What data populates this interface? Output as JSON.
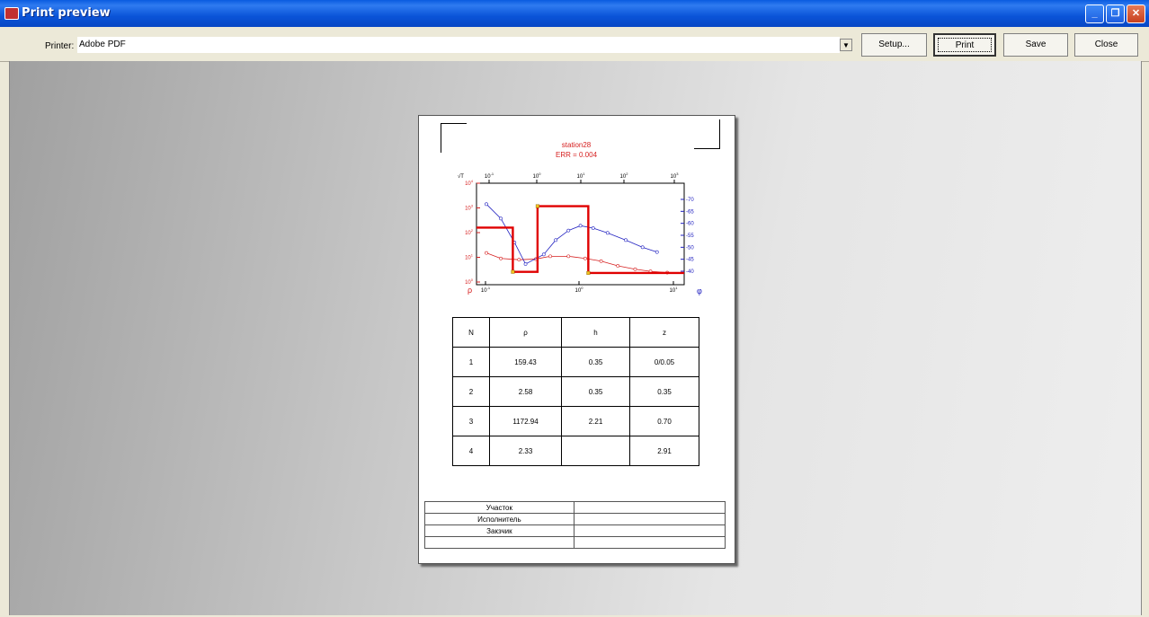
{
  "window": {
    "title": "Print preview"
  },
  "toolbar": {
    "printer_label": "Printer:",
    "printer_value": "Adobe PDF",
    "setup": "Setup...",
    "print": "Print",
    "save": "Save",
    "close": "Close"
  },
  "report": {
    "chart_title": "station28",
    "chart_subtitle": "ERR = 0.004",
    "table_headers": [
      "N",
      "ρ",
      "h",
      "z"
    ],
    "table_rows": [
      [
        "1",
        "159.43",
        "0.35",
        "0/0.05"
      ],
      [
        "2",
        "2.58",
        "0.35",
        "0.35"
      ],
      [
        "3",
        "1172.94",
        "2.21",
        "0.70"
      ],
      [
        "4",
        "2.33",
        "",
        "2.91"
      ]
    ],
    "info_rows": [
      [
        "Участок",
        ""
      ],
      [
        "Исполнитель",
        ""
      ],
      [
        "Закзчик",
        ""
      ],
      [
        "",
        ""
      ]
    ]
  },
  "chart_data": {
    "type": "line",
    "title": "station28",
    "subtitle": "ERR = 0.004",
    "x_scale": "log",
    "top_axis_label": "√T",
    "top_ticks": [
      "10^-1",
      "10^0",
      "10^1",
      "10^2",
      "10^3"
    ],
    "bottom_axis_label": "ρ",
    "bottom_ticks": [
      "10^-1",
      "10^0",
      "10^1"
    ],
    "left_axis": {
      "scale": "log",
      "ticks": [
        "10^0",
        "10^1",
        "10^2",
        "10^3",
        "10^4"
      ]
    },
    "right_axis": {
      "label": "φ",
      "ticks": [
        40,
        45,
        50,
        55,
        60,
        65,
        70
      ]
    },
    "series": [
      {
        "color": "#d62020",
        "points": [
          [
            0.1,
            15
          ],
          [
            0.15,
            9
          ],
          [
            0.25,
            8
          ],
          [
            0.4,
            8.5
          ],
          [
            0.6,
            11
          ],
          [
            1.0,
            11
          ],
          [
            1.6,
            9
          ],
          [
            2.5,
            7
          ],
          [
            4,
            4.5
          ],
          [
            6.5,
            3.3
          ],
          [
            10,
            2.7
          ],
          [
            16,
            2.4
          ]
        ]
      },
      {
        "color": "#2020c0",
        "points": [
          [
            0.1,
            68
          ],
          [
            0.15,
            62
          ],
          [
            0.22,
            52
          ],
          [
            0.3,
            43
          ],
          [
            0.5,
            47
          ],
          [
            0.7,
            53
          ],
          [
            1.0,
            57
          ],
          [
            1.4,
            59
          ],
          [
            2.0,
            58
          ],
          [
            3.0,
            56
          ],
          [
            5.0,
            53
          ],
          [
            8.0,
            50
          ],
          [
            12.0,
            48
          ]
        ]
      },
      {
        "color": "#e00000",
        "type": "step",
        "layers": [
          {
            "rho": 159.43,
            "top_depth": 0.05,
            "bottom_depth": 0.35
          },
          {
            "rho": 2.58,
            "top_depth": 0.35,
            "bottom_depth": 0.7
          },
          {
            "rho": 1172.94,
            "top_depth": 0.7,
            "bottom_depth": 2.91
          },
          {
            "rho": 2.33,
            "top_depth": 2.91,
            "bottom_depth": null
          }
        ]
      }
    ]
  }
}
